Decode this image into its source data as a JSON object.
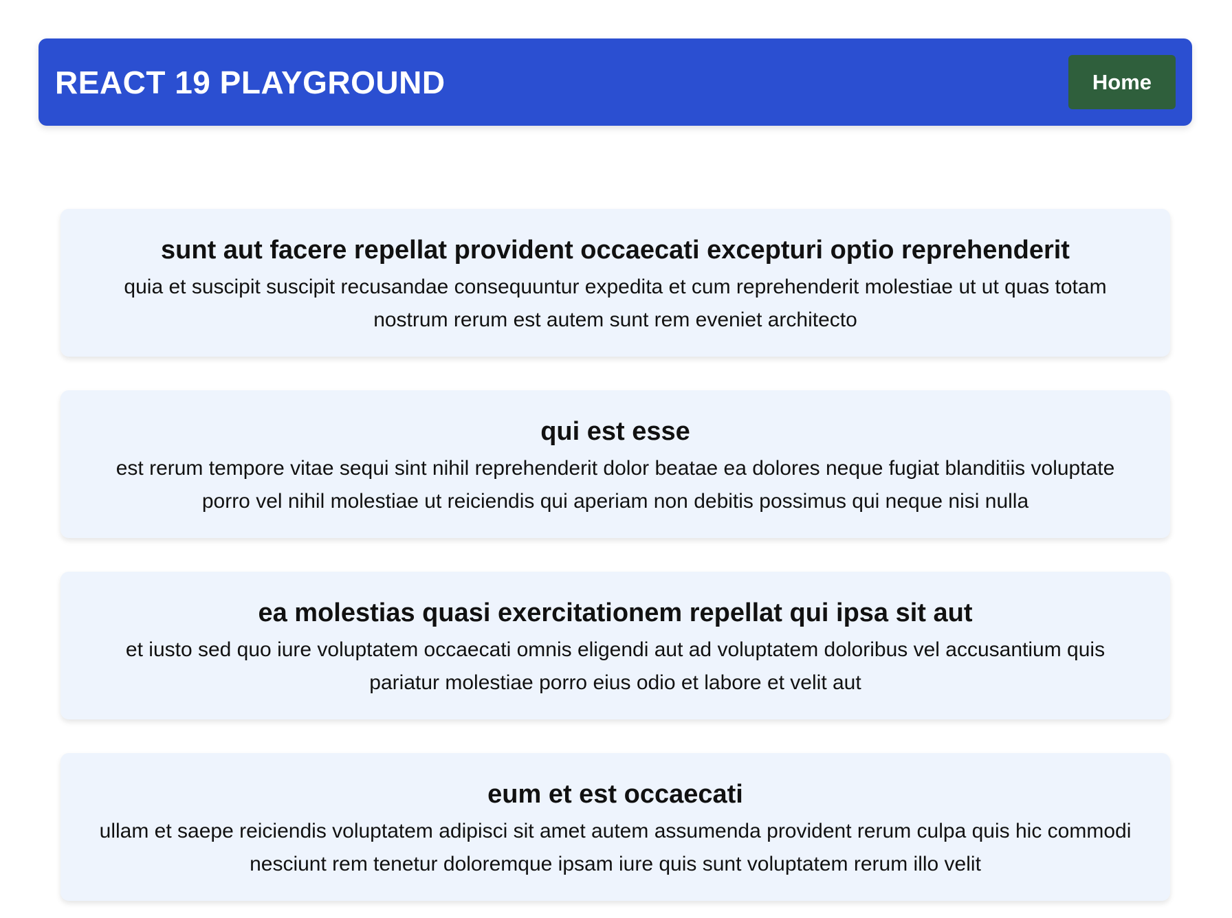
{
  "colors": {
    "navbar_bg": "#2b4fd1",
    "home_button_bg": "#2f5f3c",
    "card_bg": "#eef4fd"
  },
  "header": {
    "title": "REACT 19 PLAYGROUND",
    "home_button_label": "Home"
  },
  "posts": [
    {
      "title": "sunt aut facere repellat provident occaecati excepturi optio reprehenderit",
      "body": "quia et suscipit suscipit recusandae consequuntur expedita et cum reprehenderit molestiae ut ut quas totam nostrum rerum est autem sunt rem eveniet architecto"
    },
    {
      "title": "qui est esse",
      "body": "est rerum tempore vitae sequi sint nihil reprehenderit dolor beatae ea dolores neque fugiat blanditiis voluptate porro vel nihil molestiae ut reiciendis qui aperiam non debitis possimus qui neque nisi nulla"
    },
    {
      "title": "ea molestias quasi exercitationem repellat qui ipsa sit aut",
      "body": "et iusto sed quo iure voluptatem occaecati omnis eligendi aut ad voluptatem doloribus vel accusantium quis pariatur molestiae porro eius odio et labore et velit aut"
    },
    {
      "title": "eum et est occaecati",
      "body": "ullam et saepe reiciendis voluptatem adipisci sit amet autem assumenda provident rerum culpa quis hic commodi nesciunt rem tenetur doloremque ipsam iure quis sunt voluptatem rerum illo velit"
    }
  ]
}
